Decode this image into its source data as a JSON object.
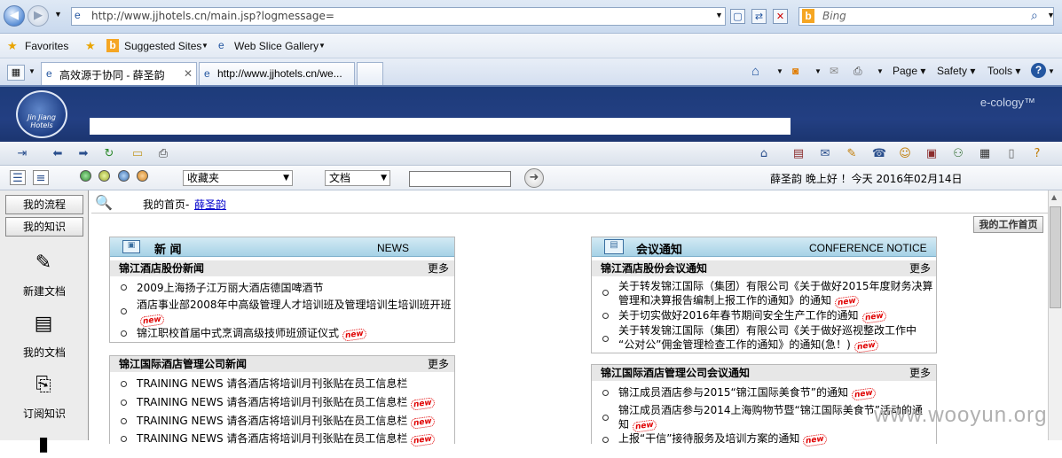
{
  "browser": {
    "url": "http://www.jjhotels.cn/main.jsp?logmessage=",
    "search_placeholder": "Bing",
    "favorites_label": "Favorites",
    "suggested_sites": "Suggested Sites",
    "web_slice_gallery": "Web Slice Gallery",
    "tabs": [
      {
        "title": "高效源于协同 - 薛圣韵"
      },
      {
        "title": "http://www.jjhotels.cn/we..."
      }
    ],
    "commands": {
      "page": "Page",
      "safety": "Safety",
      "tools": "Tools"
    }
  },
  "app": {
    "logo_text": "Jin Jiang Hotels",
    "brand": "e-cology™"
  },
  "toolbar2": {
    "favorites_select": "收藏夹",
    "doc_select": "文档",
    "greeting": "薛圣韵 晚上好 ！今天 2016年02月14日"
  },
  "left_nav": {
    "my_flow": "我的流程",
    "my_knowledge": "我的知识",
    "items": [
      {
        "label": "新建文档",
        "icon": "new-doc-icon"
      },
      {
        "label": "我的文档",
        "icon": "my-doc-icon"
      },
      {
        "label": "订阅知识",
        "icon": "subscribe-icon"
      }
    ]
  },
  "breadcrumb": {
    "prefix": "我的首页-",
    "user": "薛圣韵"
  },
  "my_workspace_button": "我的工作首页",
  "news": {
    "title": "新 闻",
    "title_en": "NEWS",
    "sections": [
      {
        "title": "锦江酒店股份新闻",
        "more": "更多",
        "items": [
          {
            "text": "2009上海扬子江万丽大酒店德国啤酒节",
            "is_new": false
          },
          {
            "text": "酒店事业部2008年中高级管理人才培训班及管理培训生培训班开班",
            "is_new": true
          },
          {
            "text": "锦江职校首届中式烹调高级技师班颁证仪式",
            "is_new": true
          }
        ]
      },
      {
        "title": "锦江国际酒店管理公司新闻",
        "more": "更多",
        "items": [
          {
            "text": "TRAINING NEWS 请各酒店将培训月刊张贴在员工信息栏",
            "is_new": false
          },
          {
            "text": "TRAINING NEWS 请各酒店将培训月刊张贴在员工信息栏",
            "is_new": true
          },
          {
            "text": "TRAINING NEWS 请各酒店将培训月刊张贴在员工信息栏",
            "is_new": true
          },
          {
            "text": "TRAINING NEWS 请各酒店将培训月刊张贴在员工信息栏",
            "is_new": true
          }
        ]
      }
    ]
  },
  "meeting": {
    "title": "会议通知",
    "title_en": "CONFERENCE NOTICE",
    "sections": [
      {
        "title": "锦江酒店股份会议通知",
        "more": "更多",
        "items": [
          {
            "line1": "关于转发锦江国际（集团）有限公司《关于做好2015年度财务决算",
            "line2": "管理和决算报告编制上报工作的通知》的通知",
            "is_new": true
          },
          {
            "line1": "关于切实做好2016年春节期间安全生产工作的通知",
            "line2": "",
            "is_new": true
          },
          {
            "line1": "关于转发锦江国际（集团）有限公司《关于做好巡视整改工作中",
            "line2": "“公对公”佣金管理检查工作的通知》的通知(急！)",
            "is_new": true
          }
        ]
      },
      {
        "title": "锦江国际酒店管理公司会议通知",
        "more": "更多",
        "items": [
          {
            "line1": "锦江成员酒店参与2015“锦江国际美食节”的通知",
            "line2": "",
            "is_new": true
          },
          {
            "line1": "锦江成员酒店参与2014上海购物节暨“锦江国际美食节”活动的通",
            "line2": "知",
            "is_new": true
          },
          {
            "line1": "上报“干信”接待服务及培训方案的通知",
            "line2": "",
            "is_new": true
          }
        ]
      }
    ]
  },
  "new_badge": "new",
  "watermark": "www.wooyun.org"
}
